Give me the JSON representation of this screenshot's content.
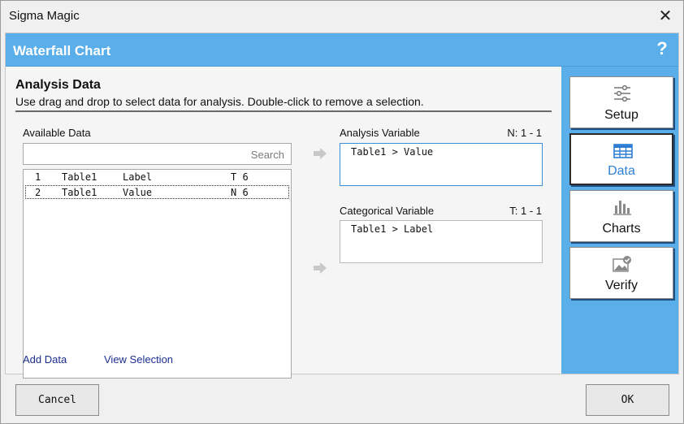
{
  "window": {
    "title": "Sigma Magic",
    "close_glyph": "✕"
  },
  "header": {
    "title": "Waterfall Chart",
    "help_glyph": "?"
  },
  "section": {
    "title": "Analysis Data",
    "description": "Use drag and drop to select data for analysis. Double-click to remove a selection."
  },
  "available": {
    "label": "Available Data",
    "search_placeholder": "Search",
    "rows": [
      {
        "num": "1",
        "table": "Table1",
        "name": "Label",
        "type": "T 6"
      },
      {
        "num": "2",
        "table": "Table1",
        "name": "Value",
        "type": "N 6"
      }
    ]
  },
  "analysis_variable": {
    "label": "Analysis Variable",
    "count": "N: 1 - 1",
    "value": "Table1 > Value"
  },
  "categorical_variable": {
    "label": "Categorical Variable",
    "count": "T: 1 - 1",
    "value": "Table1 > Label"
  },
  "links": {
    "add_data": "Add Data",
    "view_selection": "View Selection"
  },
  "nav": [
    {
      "label": "Setup",
      "icon": "sliders-icon"
    },
    {
      "label": "Data",
      "icon": "grid-icon",
      "active": true
    },
    {
      "label": "Charts",
      "icon": "bar-chart-icon"
    },
    {
      "label": "Verify",
      "icon": "image-check-icon"
    }
  ],
  "footer": {
    "cancel_label": "Cancel",
    "ok_label": "OK"
  },
  "colors": {
    "accent": "#5aaee9",
    "link": "#1a2e8f",
    "active_nav": "#2e7fd4"
  }
}
